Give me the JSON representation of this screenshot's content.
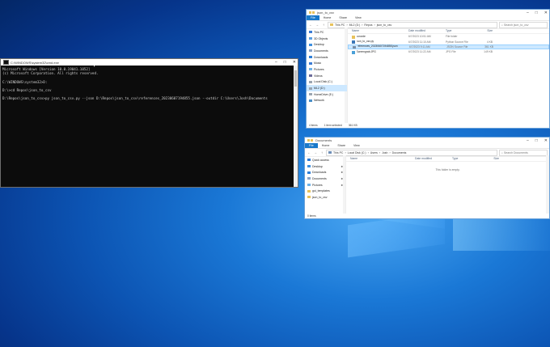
{
  "console": {
    "title": "C:\\WINDOWS\\system32\\cmd.exe",
    "lines": [
      "Microsoft Windows [Version 10.0.19041.1052]",
      "(c) Microsoft Corporation. All rights reserved.",
      "",
      "C:\\WINDOWS\\system32>D:",
      "",
      "D:\\>cd Repos\\json_to_csv",
      "",
      "D:\\Repos\\json_to_csv>py json_to_csv.py --json D:\\Repos\\json_to_csv\\references_20230607194855.json --outdir C:\\Users\\Josh\\Documents"
    ]
  },
  "explorer_top": {
    "title": "json_to_csv",
    "ribbon": [
      "File",
      "Home",
      "Share",
      "View"
    ],
    "breadcrumb": [
      "This PC",
      "ML2 (D:)",
      "Repos",
      "json_to_csv"
    ],
    "search_placeholder": "Search json_to_csv",
    "sidebar": [
      {
        "label": "This PC",
        "icon": "pc-icon",
        "selected": false
      },
      {
        "label": "3D Objects",
        "icon": "cube-icon",
        "selected": false
      },
      {
        "label": "Desktop",
        "icon": "desktop-icon",
        "selected": false
      },
      {
        "label": "Documents",
        "icon": "documents-icon",
        "selected": false
      },
      {
        "label": "Downloads",
        "icon": "download-icon",
        "selected": false
      },
      {
        "label": "Music",
        "icon": "music-icon",
        "selected": false
      },
      {
        "label": "Pictures",
        "icon": "pictures-icon",
        "selected": false
      },
      {
        "label": "Videos",
        "icon": "videos-icon",
        "selected": false
      },
      {
        "label": "Local Disk (C:)",
        "icon": "drive-icon",
        "selected": false
      },
      {
        "label": "ML2 (D:)",
        "icon": "drive-icon",
        "selected": true
      },
      {
        "label": "HomeDrive (E:)",
        "icon": "drive-icon",
        "selected": false
      },
      {
        "label": "Network",
        "icon": "network-icon",
        "selected": false
      }
    ],
    "columns": [
      "Name",
      "Date modified",
      "Type",
      "Size"
    ],
    "files": [
      {
        "name": "convole",
        "date": "6/7/2023 10:51 AM",
        "type": "File folder",
        "size": "",
        "icon": "folder-icon",
        "selected": false
      },
      {
        "name": "json_to_csv.py",
        "date": "6/7/2023 11:10 AM",
        "type": "Python Source File",
        "size": "4 KB",
        "icon": "python-file-icon",
        "selected": false
      },
      {
        "name": "references_20230607194855.json",
        "date": "6/7/2023 9:11 AM",
        "type": "JSON Source File",
        "size": "361 KB",
        "icon": "json-file-icon",
        "selected": true
      },
      {
        "name": "Screengrab.JPG",
        "date": "6/7/2023 11:22 AM",
        "type": "JPG File",
        "size": "149 KB",
        "icon": "image-file-icon",
        "selected": false
      }
    ],
    "status": [
      "4 items",
      "1 item selected",
      "361 KB"
    ]
  },
  "explorer_bottom": {
    "title": "Documents",
    "ribbon": [
      "File",
      "Home",
      "Share",
      "View"
    ],
    "breadcrumb": [
      "This PC",
      "Local Disk (C:)",
      "Users",
      "Josh",
      "Documents"
    ],
    "search_placeholder": "Search Documents",
    "sidebar": [
      {
        "label": "Quick access",
        "icon": "star-icon",
        "pinned": false
      },
      {
        "label": "Desktop",
        "icon": "desktop-icon",
        "pinned": true
      },
      {
        "label": "Downloads",
        "icon": "download-icon",
        "pinned": true
      },
      {
        "label": "Documents",
        "icon": "documents-icon",
        "pinned": true
      },
      {
        "label": "Pictures",
        "icon": "pictures-icon",
        "pinned": true
      },
      {
        "label": "gui_templates",
        "icon": "folder-icon",
        "pinned": false
      },
      {
        "label": "json_to_csv",
        "icon": "folder-icon",
        "pinned": false
      }
    ],
    "columns": [
      "Name",
      "Date modified",
      "Type",
      "Size"
    ],
    "empty_message": "This folder is empty.",
    "status": [
      "0 items"
    ]
  },
  "colors": {
    "accent": "#1979ca",
    "folder": "#e8c25b",
    "selection": "#cce8ff"
  }
}
